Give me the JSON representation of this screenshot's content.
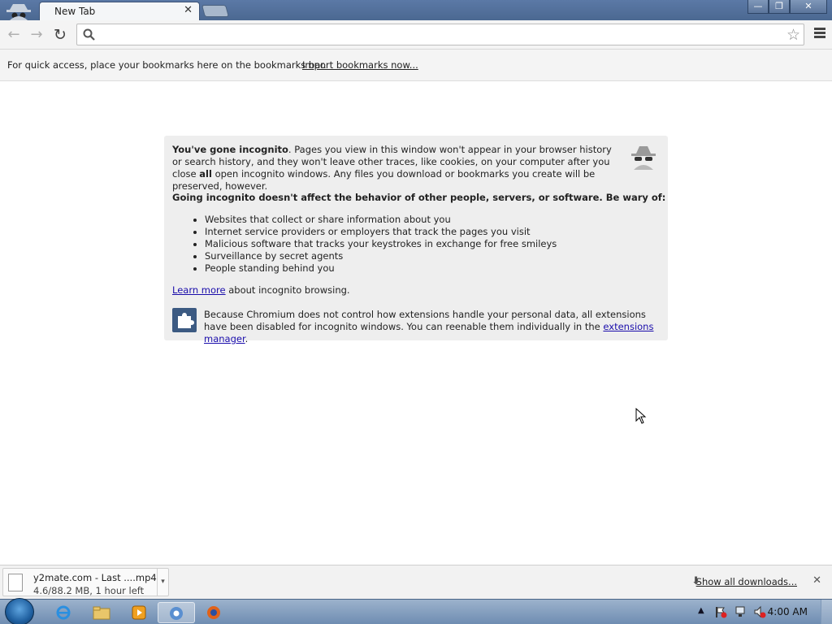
{
  "tab": {
    "title": "New Tab"
  },
  "window_controls": {
    "minimize": "—",
    "restore": "❐",
    "close": "✕"
  },
  "bookmarks_bar": {
    "text": "For quick access, place your bookmarks here on the bookmarks bar.",
    "import_link": "Import bookmarks now..."
  },
  "incognito": {
    "heading": "You've gone incognito",
    "intro": ". Pages you view in this window won't appear in your browser history or search history, and they won't leave other traces, like cookies, on your computer after you close ",
    "intro_bold": "all",
    "intro_end": " open incognito windows. Any files you download or bookmarks you create will be preserved, however.",
    "warning": "Going incognito doesn't affect the behavior of other people, servers, or software. Be wary of:",
    "items": [
      "Websites that collect or share information about you",
      "Internet service providers or employers that track the pages you visit",
      "Malicious software that tracks your keystrokes in exchange for free smileys",
      "Surveillance by secret agents",
      "People standing behind you"
    ],
    "learn_more_link": "Learn more",
    "learn_more_rest": " about incognito browsing.",
    "extensions_text": "Because Chromium does not control how extensions handle your personal data, all extensions have been disabled for incognito windows. You can reenable them individually in the ",
    "extensions_link": "extensions manager",
    "extensions_end": "."
  },
  "download": {
    "filename": "y2mate.com - Last ....mp4",
    "status": "4.6/88.2 MB, 1 hour left",
    "show_all": "Show all downloads..."
  },
  "taskbar": {
    "clock": "4:00 AM",
    "apps": [
      "internet-explorer",
      "file-explorer",
      "media-player",
      "chromium",
      "firefox"
    ]
  }
}
